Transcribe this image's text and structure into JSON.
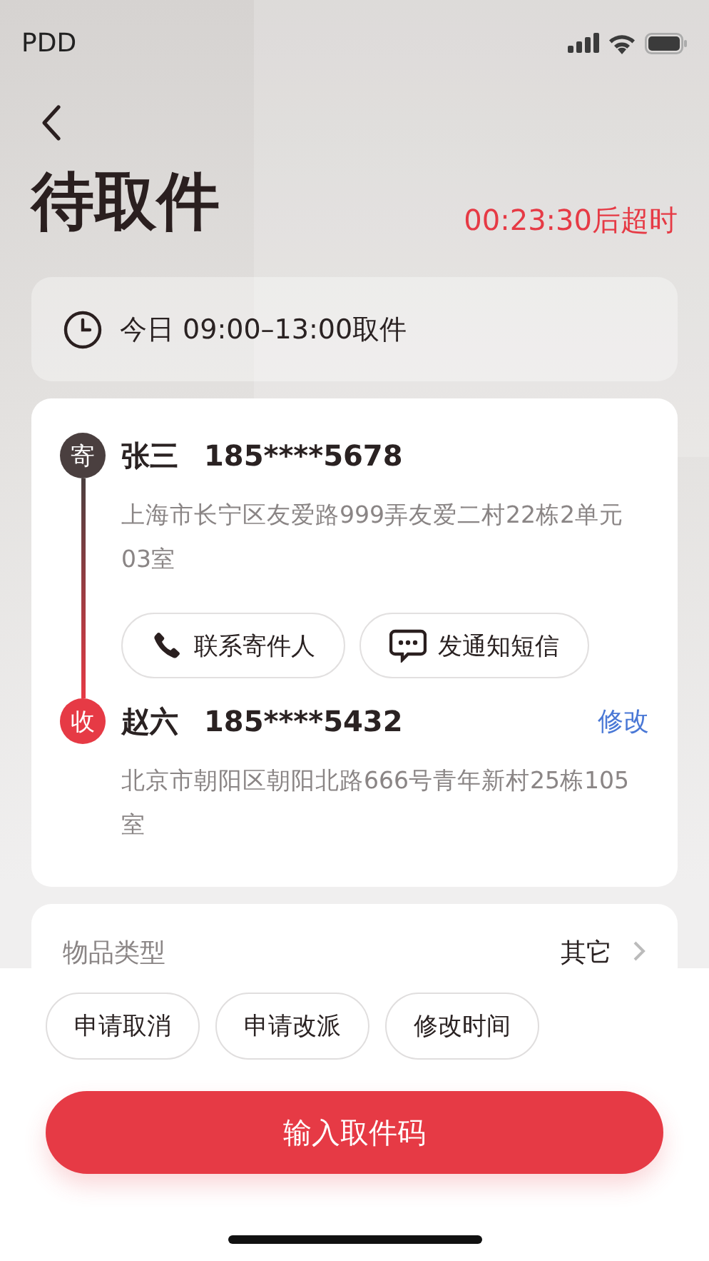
{
  "status_bar": {
    "carrier": "PDD"
  },
  "header": {
    "title": "待取件",
    "countdown": "00:23:30后超时"
  },
  "pickup_time": {
    "text": "今日 09:00–13:00取件"
  },
  "route": {
    "stops": [
      {
        "kind": "sender",
        "badge": "寄",
        "name": "张三",
        "phone": "185****5678",
        "address": "上海市长宁区友爱路999弄友爱二村22栋2单元03室",
        "actions": [
          {
            "kind": "phone",
            "label": "联系寄件人"
          },
          {
            "kind": "message",
            "label": "发通知短信"
          }
        ]
      },
      {
        "kind": "receiver",
        "badge": "收",
        "name": "赵六",
        "phone": "185****5432",
        "address": "北京市朝阳区朝阳北路666号青年新村25栋105室",
        "edit": "修改"
      }
    ]
  },
  "item_info": {
    "label": "物品类型",
    "value": "其它"
  },
  "bottom_actions": [
    "申请取消",
    "申请改派",
    "修改时间"
  ],
  "primary_button": "输入取件码"
}
